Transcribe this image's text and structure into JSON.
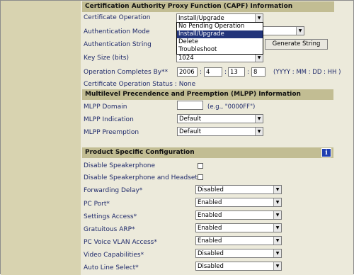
{
  "capf": {
    "header": "Certification Authority Proxy Function (CAPF) Information",
    "cert_operation_label": "Certificate Operation",
    "cert_operation_value": "Install/Upgrade",
    "cert_operation_options": [
      "No Pending Operation",
      "Install/Upgrade",
      "Delete",
      "Troubleshoot"
    ],
    "auth_mode_label": "Authentication Mode",
    "auth_string_label": "Authentication String",
    "generate_button": "Generate String",
    "key_size_label": "Key Size (bits)",
    "key_size_value": "1024",
    "completes_by_label": "Operation Completes By**",
    "year": "2006",
    "month": "4",
    "day": "13",
    "hour": "8",
    "date_format": "(YYYY : MM : DD : HH )",
    "sep": ":",
    "status_label": "Certificate Operation Status : None"
  },
  "mlpp": {
    "header": "Multilevel Precendence and Preemption (MLPP) Information",
    "domain_label": "MLPP Domain",
    "domain_hint": "(e.g., \"0000FF\")",
    "indication_label": "MLPP Indication",
    "indication_value": "Default",
    "preemption_label": "MLPP Preemption",
    "preemption_value": "Default"
  },
  "product": {
    "header": "Product Specific Configuration",
    "info_icon": "i",
    "disable_speakerphone": "Disable Speakerphone",
    "disable_speakerphone_headset": "Disable Speakerphone and Headset",
    "rows": [
      {
        "label": "Forwarding Delay*",
        "value": "Disabled"
      },
      {
        "label": "PC Port*",
        "value": "Enabled"
      },
      {
        "label": "Settings Access*",
        "value": "Enabled"
      },
      {
        "label": "Gratuitous ARP*",
        "value": "Enabled"
      },
      {
        "label": "PC Voice VLAN Access*",
        "value": "Enabled"
      },
      {
        "label": "Video Capabilities*",
        "value": "Disabled"
      },
      {
        "label": "Auto Line Select*",
        "value": "Disabled"
      }
    ]
  }
}
